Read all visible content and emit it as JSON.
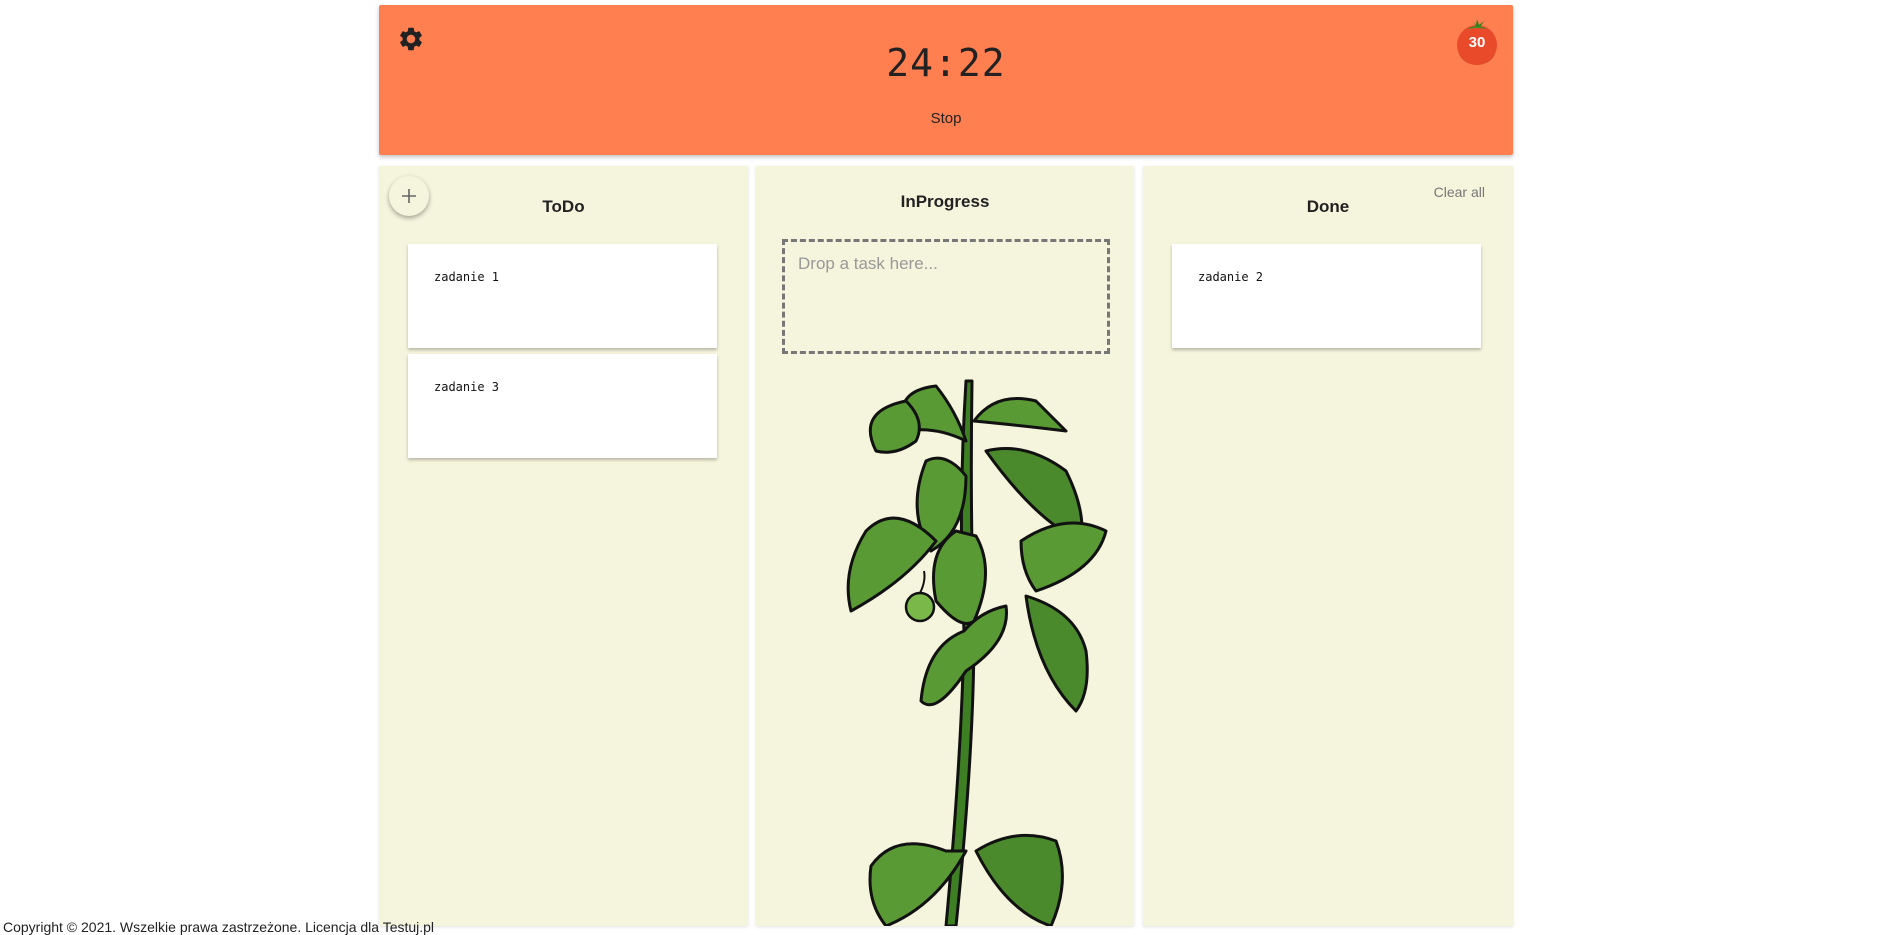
{
  "header": {
    "timer": "24:22",
    "stop_label": "Stop",
    "tomato_count": "30",
    "icons": {
      "settings": "gear-icon",
      "counter": "tomato-icon"
    },
    "bg_color": "#ff7f50"
  },
  "columns": {
    "todo": {
      "title": "ToDo",
      "add_icon": "plus-icon",
      "tasks": [
        {
          "text": "zadanie 1"
        },
        {
          "text": "zadanie 3"
        }
      ]
    },
    "inprogress": {
      "title": "InProgress",
      "drop_placeholder": "Drop a task here...",
      "illustration": "tomato-plant"
    },
    "done": {
      "title": "Done",
      "clear_label": "Clear all",
      "tasks": [
        {
          "text": "zadanie 2"
        }
      ]
    },
    "bg_color": "#f5f4dc"
  },
  "footer": {
    "text": "Copyright © 2021. Wszelkie prawa zastrzeżone. Licencja dla Testuj.pl"
  }
}
